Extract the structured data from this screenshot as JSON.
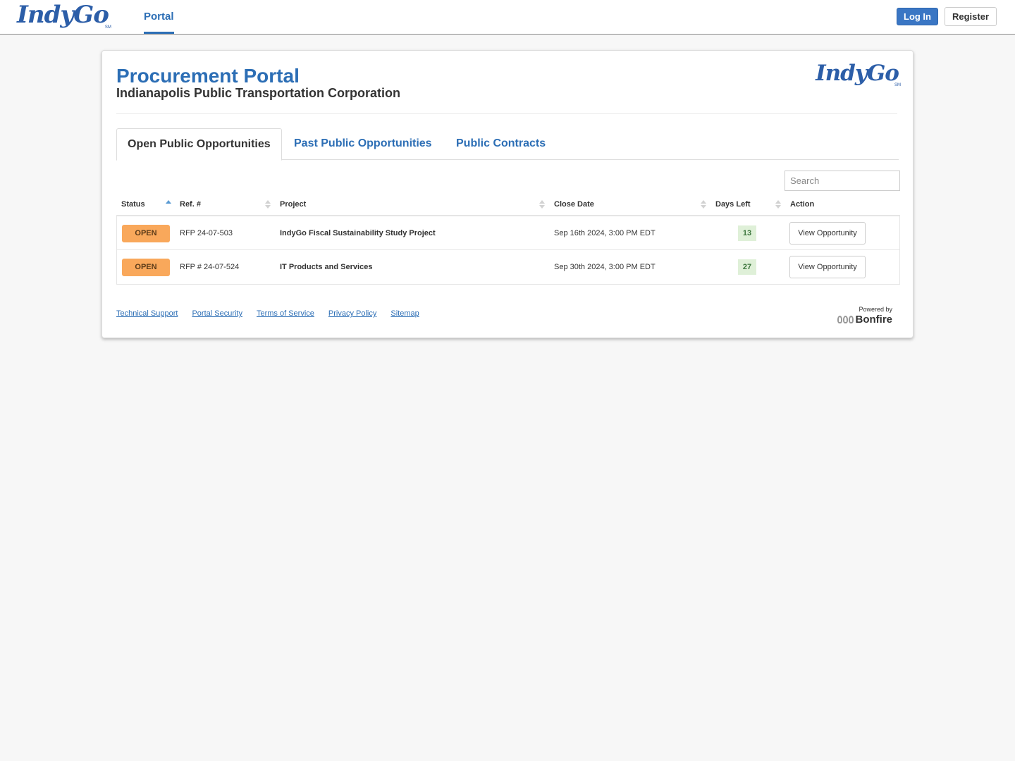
{
  "topbar": {
    "logo_text": "IndyGo",
    "logo_mark": "SM",
    "nav_items": [
      {
        "label": "Portal",
        "active": true
      }
    ],
    "login_label": "Log In",
    "register_label": "Register"
  },
  "header": {
    "title": "Procurement Portal",
    "subtitle": "Indianapolis Public Transportation Corporation",
    "logo_text": "IndyGo",
    "logo_mark": "SM"
  },
  "tabs": [
    {
      "label": "Open Public Opportunities",
      "active": true
    },
    {
      "label": "Past Public Opportunities",
      "active": false
    },
    {
      "label": "Public Contracts",
      "active": false
    }
  ],
  "search": {
    "placeholder": "Search",
    "value": ""
  },
  "table": {
    "columns": [
      {
        "label": "Status",
        "sort": "asc"
      },
      {
        "label": "Ref. #",
        "sort": "none"
      },
      {
        "label": "Project",
        "sort": "none"
      },
      {
        "label": "Close Date",
        "sort": "none"
      },
      {
        "label": "Days Left",
        "sort": "none"
      },
      {
        "label": "Action",
        "sort": "none"
      }
    ],
    "rows": [
      {
        "status": "OPEN",
        "ref": "RFP 24-07-503",
        "project": "IndyGo Fiscal Sustainability Study Project",
        "close_date": "Sep 16th 2024, 3:00 PM EDT",
        "days_left": "13",
        "action": "View Opportunity"
      },
      {
        "status": "OPEN",
        "ref": "RFP # 24-07-524",
        "project": "IT Products and Services",
        "close_date": "Sep 30th 2024, 3:00 PM EDT",
        "days_left": "27",
        "action": "View Opportunity"
      }
    ]
  },
  "footer": {
    "links": [
      "Technical Support",
      "Portal Security",
      "Terms of Service",
      "Privacy Policy",
      "Sitemap"
    ],
    "powered_by": "Powered by",
    "brand": "Bonfire"
  },
  "colors": {
    "brand_blue": "#2c6eb5",
    "login_button": "#3a76c4",
    "status_open": "#f9a85b",
    "days_left_bg": "#dff0d8",
    "days_left_text": "#3c763d",
    "page_bg": "#f7f7f7"
  }
}
